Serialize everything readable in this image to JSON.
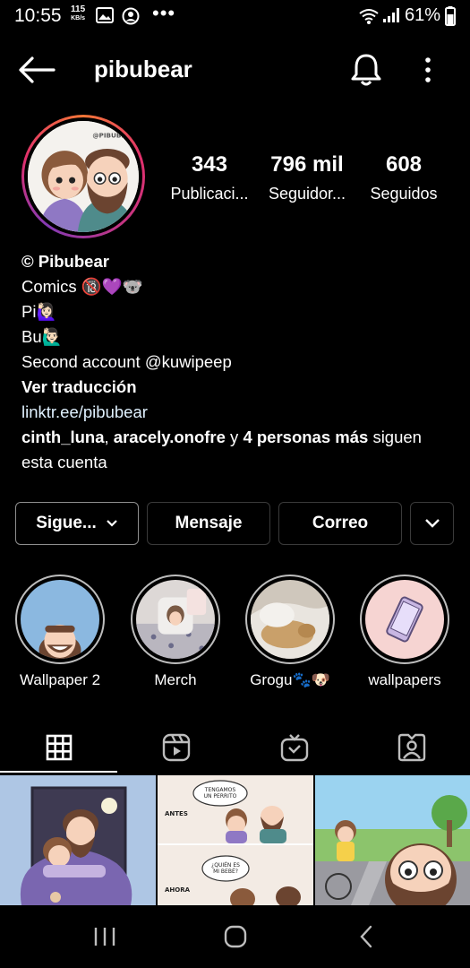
{
  "status_bar": {
    "time": "10:55",
    "speed_value": "115",
    "speed_unit": "KB/s",
    "more": "•••",
    "battery": "61%"
  },
  "header": {
    "username": "pibubear"
  },
  "stats": [
    {
      "value": "343",
      "label": "Publicaci..."
    },
    {
      "value": "796 mil",
      "label": "Seguidor..."
    },
    {
      "value": "608",
      "label": "Seguidos"
    }
  ],
  "bio": {
    "name": "© Pibubear",
    "line1": "Comics 🔞💜🐨",
    "line2": "Pi🙋🏻‍♀️",
    "line3": "Bu🙋🏻‍♂️",
    "line4": "Second account @kuwipeep",
    "translate": "Ver traducción",
    "link": "linktr.ee/pibubear",
    "followed_user1": "cinth_luna",
    "followed_sep": ",",
    "followed_user2": "aracely.onofre",
    "followed_and": "y",
    "followed_others": "4 personas más",
    "followed_tail": "siguen esta cuenta"
  },
  "actions": {
    "following": "Sigue...",
    "message": "Mensaje",
    "email": "Correo"
  },
  "highlights": [
    {
      "label": "Wallpaper 2"
    },
    {
      "label": "Merch"
    },
    {
      "label": "Grogu🐾🐶"
    },
    {
      "label": "wallpapers"
    }
  ],
  "comic2": {
    "bubble1": "TENGAMOS UN PERRITO",
    "before": "ANTES",
    "bubble2": "¿QUIÉN ES MI BEBÉ?",
    "now": "AHORA"
  },
  "colors": {
    "background": "#000000",
    "link": "#e0f1ff",
    "avatar_gradient": [
      "#f77737",
      "#e1306c",
      "#833ab4"
    ]
  }
}
